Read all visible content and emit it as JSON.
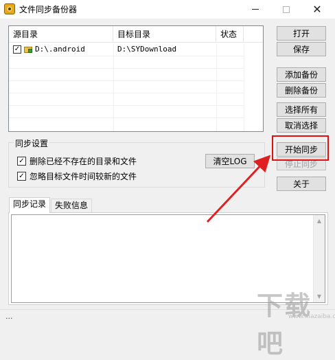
{
  "window": {
    "title": "文件同步备份器",
    "minimize_label": "",
    "maximize_label": "",
    "close_label": "✕"
  },
  "list": {
    "columns": [
      "源目录",
      "目标目录",
      "状态"
    ],
    "rows": [
      {
        "checked": true,
        "source": "D:\\.android",
        "target": "D:\\SYDownload",
        "status": ""
      }
    ]
  },
  "buttons": {
    "open": "打开",
    "save": "保存",
    "add_backup": "添加备份",
    "delete_backup": "删除备份",
    "select_all": "选择所有",
    "deselect": "取消选择",
    "start_sync": "开始同步",
    "stop_sync": "停止同步",
    "about": "关于",
    "clear_log": "清空LOG"
  },
  "sync_settings": {
    "title": "同步设置",
    "options": [
      {
        "label": "删除已经不存在的目录和文件",
        "checked": true
      },
      {
        "label": "忽略目标文件时间较新的文件",
        "checked": true
      }
    ]
  },
  "tabs": [
    {
      "label": "同步记录",
      "active": true
    },
    {
      "label": "失败信息",
      "active": false
    }
  ],
  "log": {
    "content": ""
  },
  "status": {
    "text": "..."
  },
  "watermark": {
    "text": "下载吧",
    "sub": "www.xiazaiba.com"
  },
  "colors": {
    "highlight": "#e01010",
    "arrow": "#e02020"
  }
}
